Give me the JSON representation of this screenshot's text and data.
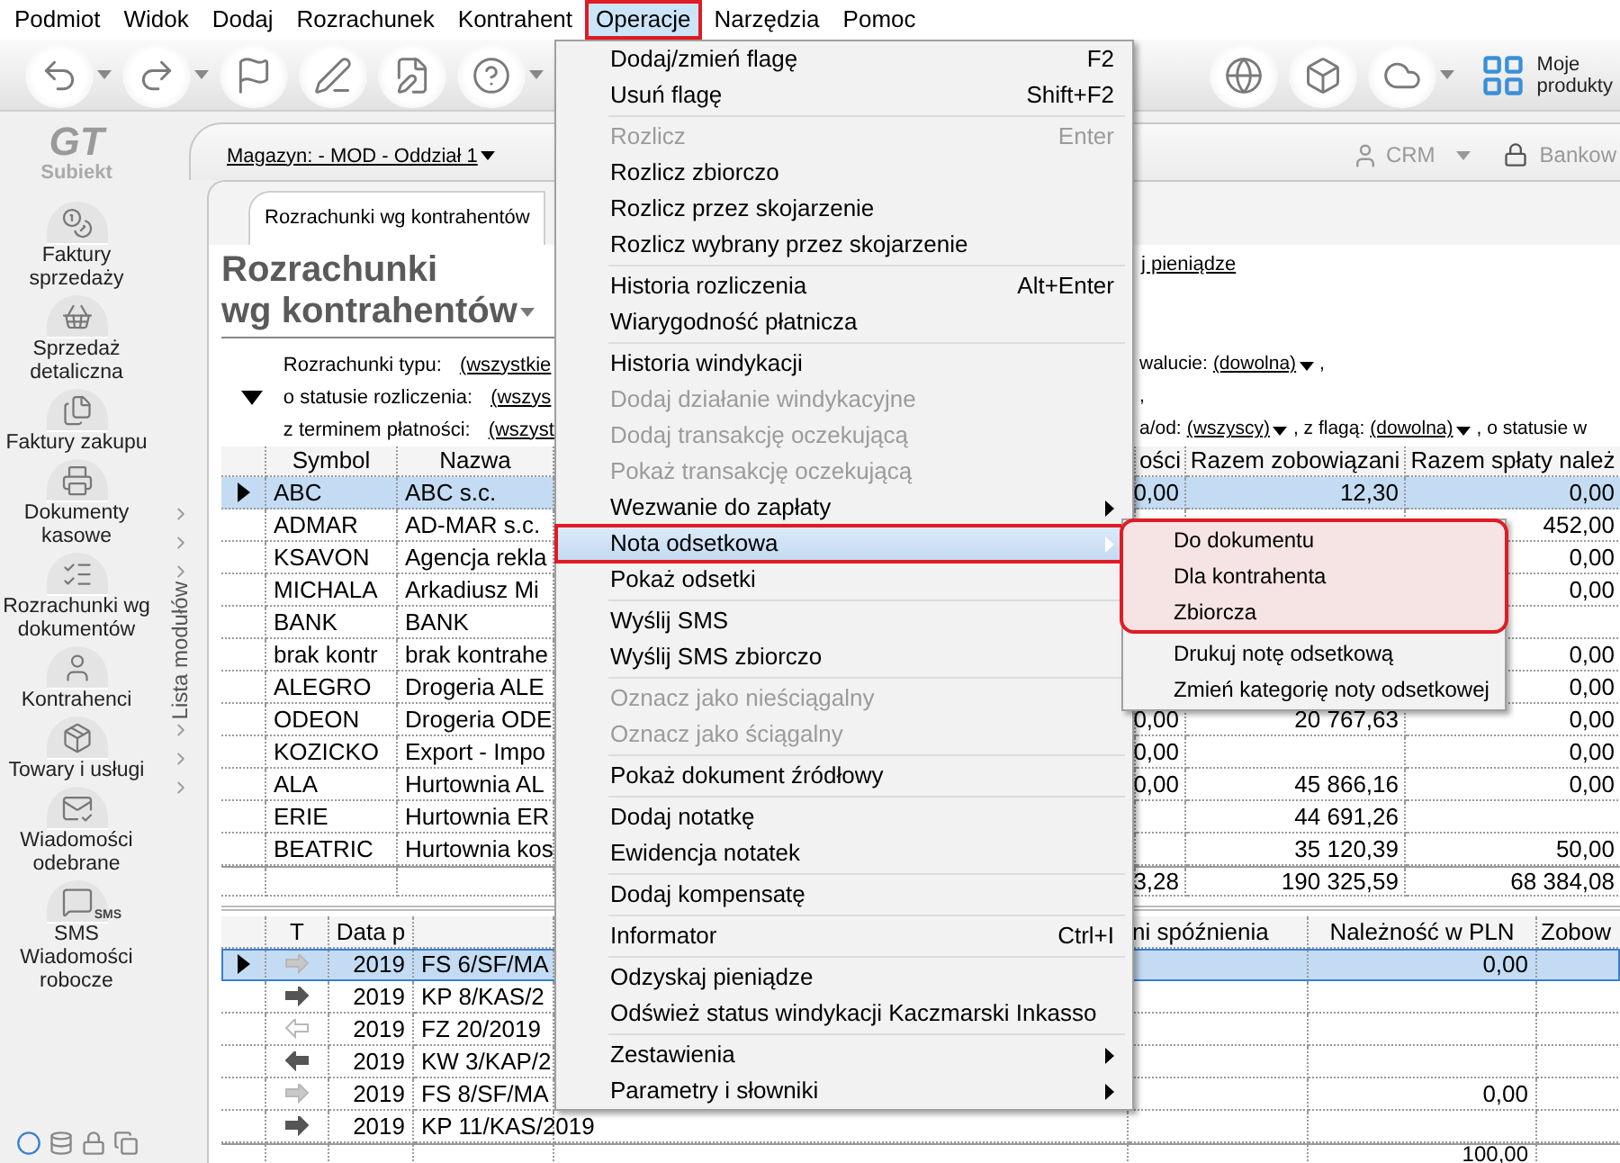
{
  "menu_bar": [
    {
      "label": "Podmiot",
      "selected": false,
      "annotated": false
    },
    {
      "label": "Widok",
      "selected": false,
      "annotated": false
    },
    {
      "label": "Dodaj",
      "selected": false,
      "annotated": false
    },
    {
      "label": "Rozrachunek",
      "selected": false,
      "annotated": false
    },
    {
      "label": "Kontrahent",
      "selected": false,
      "annotated": false
    },
    {
      "label": "Operacje",
      "selected": true,
      "annotated": true
    },
    {
      "label": "Narzędzia",
      "selected": false,
      "annotated": false
    },
    {
      "label": "Pomoc",
      "selected": false,
      "annotated": false
    }
  ],
  "toolbar": {
    "products_label": "Moje\nprodukty"
  },
  "sidebar": {
    "logo_mark": "GT",
    "logo_text": "Subiekt",
    "panel_title": "Lista modułów",
    "modules": [
      {
        "label": "Faktury\nsprzedaży"
      },
      {
        "label": "Sprzedaż\ndetaliczna"
      },
      {
        "label": "Faktury zakupu"
      },
      {
        "label": "Dokumenty\nkasowe"
      },
      {
        "label": "Rozrachunki wg\ndokumentów"
      },
      {
        "label": "Kontrahenci"
      },
      {
        "label": "Towary i usługi"
      },
      {
        "label": "Wiadomości\nodebrane"
      },
      {
        "label": "SMS\nWiadomości\nrobocze",
        "icon_text": "SMS"
      }
    ]
  },
  "header": {
    "warehouse": "Magazyn: - MOD - Oddział 1",
    "crm": "CRM",
    "bank": "Bankow"
  },
  "tabs": [
    {
      "label": "Rozrachunki wg kontrahentów",
      "selected": true
    }
  ],
  "title": "Rozrachunki\nwg kontrahentów",
  "recover_link": "j pieniądze",
  "filters_left": [
    {
      "label": "Rozrachunki typu:",
      "value": "(wszystkie"
    },
    {
      "label": "o statusie rozliczenia:",
      "value": "(wszys"
    },
    {
      "label": "z terminem płatności:",
      "value": "(wszyst"
    }
  ],
  "filters_right": [
    [
      {
        "kind": "label",
        "text": "walucie:"
      },
      {
        "kind": "dropdown",
        "text": "(dowolna)"
      },
      {
        "kind": "label",
        "text": ","
      }
    ],
    [
      {
        "kind": "label",
        "text": ","
      }
    ],
    [
      {
        "kind": "label",
        "text": "a/od:"
      },
      {
        "kind": "dropdown",
        "text": "(wszyscy)"
      },
      {
        "kind": "label",
        "text": ", z flagą:"
      },
      {
        "kind": "dropdown",
        "text": "(dowolna)"
      },
      {
        "kind": "label",
        "text": ", o statusie w"
      }
    ]
  ],
  "accounts_table": {
    "columns": [
      "Symbol",
      "Nazwa",
      "ości",
      "Razem zobowiązani",
      "Razem spłaty należ"
    ],
    "rows": [
      {
        "selected": true,
        "cells": [
          "ABC",
          "ABC s.c.",
          "0,00",
          "12,30",
          "0,00"
        ]
      },
      {
        "selected": false,
        "cells": [
          "ADMAR",
          "AD-MAR s.c.",
          null,
          null,
          "452,00"
        ]
      },
      {
        "selected": false,
        "cells": [
          "KSAVON",
          "Agencja rekla",
          null,
          null,
          "0,00"
        ]
      },
      {
        "selected": false,
        "cells": [
          "MICHALA",
          "Arkadiusz Mi",
          null,
          null,
          "0,00"
        ]
      },
      {
        "selected": false,
        "cells": [
          "BANK",
          "BANK",
          null,
          null,
          null
        ]
      },
      {
        "selected": false,
        "cells": [
          "brak kontr",
          "brak kontrahe",
          null,
          null,
          "0,00"
        ]
      },
      {
        "selected": false,
        "cells": [
          "ALEGRO",
          "Drogeria ALE",
          null,
          null,
          "0,00"
        ]
      },
      {
        "selected": false,
        "cells": [
          "ODEON",
          "Drogeria ODE",
          "0,00",
          "20 767,63",
          "0,00"
        ]
      },
      {
        "selected": false,
        "cells": [
          "KOZICKO",
          "Export - Impo",
          "0,00",
          null,
          "0,00"
        ]
      },
      {
        "selected": false,
        "cells": [
          "ALA",
          "Hurtownia AL",
          "0,00",
          "45 866,16",
          "0,00"
        ]
      },
      {
        "selected": false,
        "cells": [
          "ERIE",
          "Hurtownia ER",
          null,
          "44 691,26",
          null
        ]
      },
      {
        "selected": false,
        "cells": [
          "BEATRIC",
          "Hurtownia kos",
          null,
          "35 120,39",
          "50,00"
        ]
      }
    ],
    "totals": [
      "3,28",
      "190 325,59",
      "68 384,08"
    ]
  },
  "documents_table": {
    "columns": [
      "T",
      "Data p",
      null,
      "ni spóźnienia",
      "Należność w PLN",
      "Zobow"
    ],
    "rows": [
      {
        "selected": true,
        "reversed": false,
        "faded": true,
        "cells": [
          null,
          "2019",
          "FS 6/SF/MA",
          null,
          "0,00",
          null
        ]
      },
      {
        "selected": false,
        "reversed": false,
        "faded": false,
        "cells": [
          null,
          "2019",
          "KP 8/KAS/2",
          null,
          null,
          null
        ]
      },
      {
        "selected": false,
        "reversed": true,
        "faded": true,
        "cells": [
          null,
          "2019",
          "FZ 20/2019",
          null,
          null,
          null
        ]
      },
      {
        "selected": false,
        "reversed": true,
        "faded": false,
        "cells": [
          null,
          "2019",
          "KW 3/KAP/2",
          null,
          null,
          null
        ]
      },
      {
        "selected": false,
        "reversed": false,
        "faded": true,
        "cells": [
          null,
          "2019",
          "FS 8/SF/MA",
          null,
          "0,00",
          null
        ]
      },
      {
        "selected": false,
        "reversed": false,
        "faded": false,
        "cells": [
          null,
          "2019",
          "KP 11/KAS/2019",
          null,
          null,
          null
        ]
      }
    ],
    "footer": "100,00"
  },
  "menu": {
    "groups": [
      {
        "items": [
          {
            "label": "Dodaj/zmień flagę",
            "shortcut": "F2",
            "disabled": false,
            "submenu": false,
            "selected": false,
            "annotated": false
          },
          {
            "label": "Usuń flagę",
            "shortcut": "Shift+F2",
            "disabled": false,
            "submenu": false,
            "selected": false,
            "annotated": false
          }
        ]
      },
      {
        "items": [
          {
            "label": "Rozlicz",
            "shortcut": "Enter",
            "disabled": true,
            "submenu": false,
            "selected": false,
            "annotated": false
          },
          {
            "label": "Rozlicz zbiorczo",
            "disabled": false,
            "submenu": false,
            "selected": false,
            "annotated": false
          },
          {
            "label": "Rozlicz przez skojarzenie",
            "disabled": false,
            "submenu": false,
            "selected": false,
            "annotated": false
          },
          {
            "label": "Rozlicz wybrany przez skojarzenie",
            "disabled": false,
            "submenu": false,
            "selected": false,
            "annotated": false
          }
        ]
      },
      {
        "items": [
          {
            "label": "Historia rozliczenia",
            "shortcut": "Alt+Enter",
            "disabled": false,
            "submenu": false,
            "selected": false,
            "annotated": false
          },
          {
            "label": "Wiarygodność płatnicza",
            "disabled": false,
            "submenu": false,
            "selected": false,
            "annotated": false
          }
        ]
      },
      {
        "items": [
          {
            "label": "Historia windykacji",
            "disabled": false,
            "submenu": false,
            "selected": false,
            "annotated": false
          },
          {
            "label": "Dodaj działanie windykacyjne",
            "disabled": true,
            "submenu": false,
            "selected": false,
            "annotated": false
          },
          {
            "label": "Dodaj transakcję oczekującą",
            "disabled": true,
            "submenu": false,
            "selected": false,
            "annotated": false
          },
          {
            "label": "Pokaż transakcję oczekującą",
            "disabled": true,
            "submenu": false,
            "selected": false,
            "annotated": false
          },
          {
            "label": "Wezwanie do zapłaty",
            "disabled": false,
            "submenu": true,
            "selected": false,
            "annotated": false
          },
          {
            "label": "Nota odsetkowa",
            "disabled": false,
            "submenu": true,
            "selected": true,
            "annotated": true
          },
          {
            "label": "Pokaż odsetki",
            "disabled": false,
            "submenu": false,
            "selected": false,
            "annotated": false
          }
        ]
      },
      {
        "items": [
          {
            "label": "Wyślij SMS",
            "disabled": false,
            "submenu": false,
            "selected": false,
            "annotated": false
          },
          {
            "label": "Wyślij SMS zbiorczo",
            "disabled": false,
            "submenu": false,
            "selected": false,
            "annotated": false
          }
        ]
      },
      {
        "items": [
          {
            "label": "Oznacz jako nieściągalny",
            "disabled": true,
            "submenu": false,
            "selected": false,
            "annotated": false
          },
          {
            "label": "Oznacz jako ściągalny",
            "disabled": true,
            "submenu": false,
            "selected": false,
            "annotated": false
          }
        ]
      },
      {
        "items": [
          {
            "label": "Pokaż dokument źródłowy",
            "disabled": false,
            "submenu": false,
            "selected": false,
            "annotated": false
          }
        ]
      },
      {
        "items": [
          {
            "label": "Dodaj notatkę",
            "disabled": false,
            "submenu": false,
            "selected": false,
            "annotated": false
          },
          {
            "label": "Ewidencja notatek",
            "disabled": false,
            "submenu": false,
            "selected": false,
            "annotated": false
          }
        ]
      },
      {
        "items": [
          {
            "label": "Dodaj kompensatę",
            "disabled": false,
            "submenu": false,
            "selected": false,
            "annotated": false
          }
        ]
      },
      {
        "items": [
          {
            "label": "Informator",
            "shortcut": "Ctrl+I",
            "disabled": false,
            "submenu": false,
            "selected": false,
            "annotated": false
          }
        ]
      },
      {
        "items": [
          {
            "label": "Odzyskaj pieniądze",
            "disabled": false,
            "submenu": false,
            "selected": false,
            "annotated": false
          },
          {
            "label": "Odśwież status windykacji Kaczmarski Inkasso",
            "disabled": false,
            "submenu": false,
            "selected": false,
            "annotated": false
          }
        ]
      },
      {
        "items": [
          {
            "label": "Zestawienia",
            "disabled": false,
            "submenu": true,
            "selected": false,
            "annotated": false
          },
          {
            "label": "Parametry i słowniki",
            "disabled": false,
            "submenu": true,
            "selected": false,
            "annotated": false
          }
        ]
      }
    ]
  },
  "submenu": {
    "groups": [
      {
        "annotated": true,
        "items": [
          {
            "label": "Do dokumentu"
          },
          {
            "label": "Dla kontrahenta"
          },
          {
            "label": "Zbiorcza"
          }
        ]
      },
      {
        "annotated": false,
        "items": [
          {
            "label": "Drukuj notę odsetkową"
          },
          {
            "label": "Zmień kategorię noty odsetkowej"
          }
        ]
      }
    ]
  }
}
